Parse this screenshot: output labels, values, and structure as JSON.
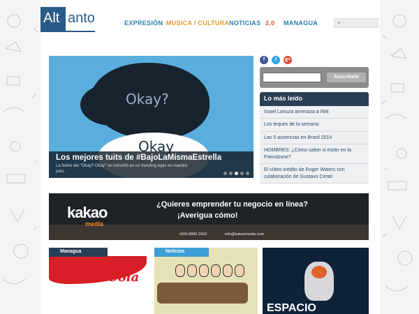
{
  "header": {
    "logo_part1": "Alt",
    "logo_part2": "anto",
    "nav": [
      {
        "label": "EXPRESIÓN",
        "color": "#2a7fb0"
      },
      {
        "label": "MUSICA / CULTURA",
        "color": "#e59a2e"
      },
      {
        "label": "NOTICIAS",
        "color": "#2a7fb0"
      },
      {
        "label": "2.0",
        "color": "#e05a2e"
      },
      {
        "label": "MANAGUA",
        "color": "#2a7fb0"
      }
    ]
  },
  "slider": {
    "image_text_top": "Okay?",
    "image_text_bottom": "Okay",
    "title": "Los mejores tuits de #BajoLaMismaEstrella",
    "summary": "La fiebre del \"Okay? Okay\" se convirtió en un trending topic en nuestro país.",
    "active_dot": 2,
    "dot_count": 5
  },
  "social": [
    {
      "icon": "facebook-icon",
      "glyph": "f",
      "color": "#3b5998"
    },
    {
      "icon": "twitter-icon",
      "glyph": "t",
      "color": "#2ea5e0"
    },
    {
      "icon": "google-plus-icon",
      "glyph": "g+",
      "color": "#dd4b39"
    }
  ],
  "subscribe": {
    "button_label": "Suscribete"
  },
  "most_read": {
    "title": "Lo más leído",
    "items": [
      "Israel Lanuza amenaza a INN",
      "Los teques de la semana",
      "Las 5 ausencias en Brasil 2014",
      "HOMBRES: ¿Cómo saber si están en la Friendzone?",
      "El vídeo inédito de Roger Waters con colaboración de Gustavo Cerati"
    ]
  },
  "banner": {
    "brand": "kakao",
    "brand_sub": "media",
    "line1": "¿Quieres emprender tu negocio en línea?",
    "line2": "¡Averigua cómo!",
    "phone": "+505-8880 2422",
    "email": "info@kakaomedia.com"
  },
  "cards": [
    {
      "tag": "Managua",
      "image_text": "Coca-Cola"
    },
    {
      "tag": "Noticias"
    },
    {
      "image_text": "ESPACIO"
    }
  ]
}
